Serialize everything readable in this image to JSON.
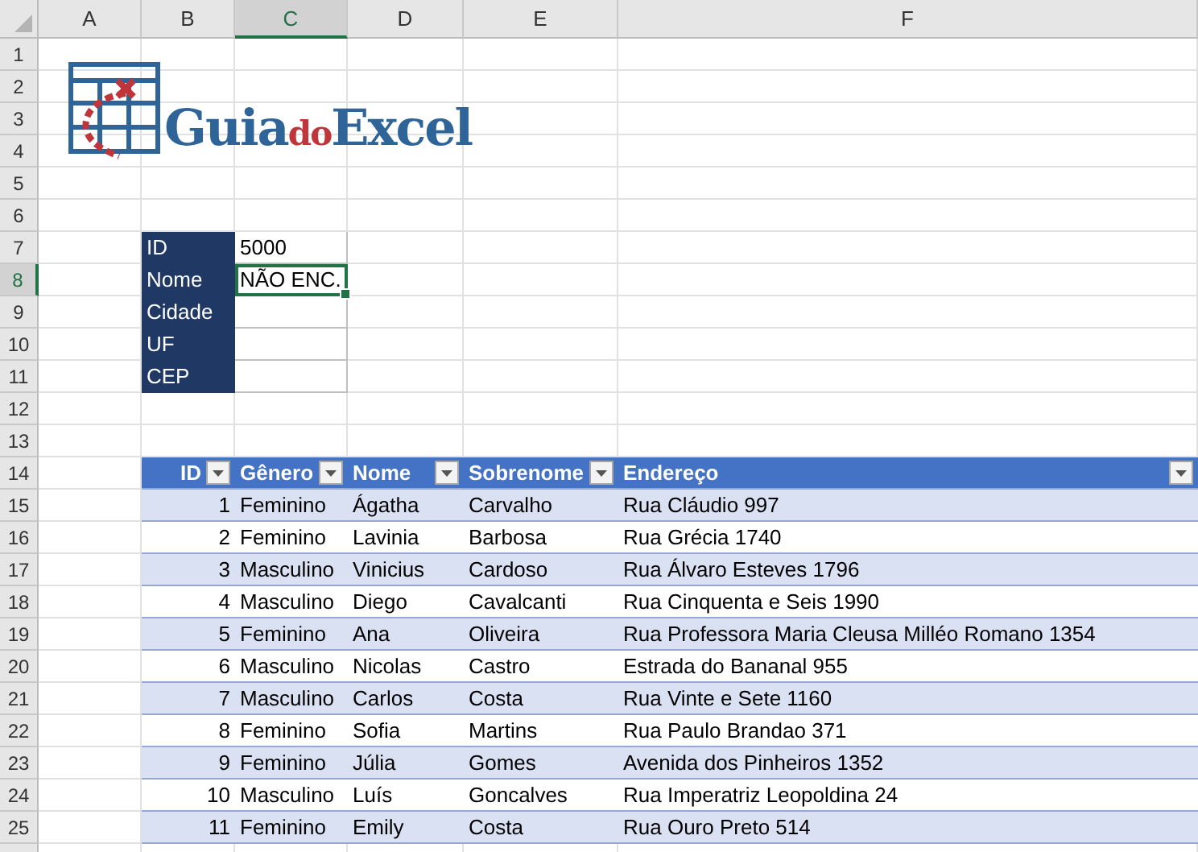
{
  "column_headers": [
    {
      "label": "A",
      "selected": false
    },
    {
      "label": "B",
      "selected": false
    },
    {
      "label": "C",
      "selected": true
    },
    {
      "label": "D",
      "selected": false
    },
    {
      "label": "E",
      "selected": false
    },
    {
      "label": "F",
      "selected": false
    }
  ],
  "row_numbers": [
    {
      "label": "1",
      "selected": false
    },
    {
      "label": "2",
      "selected": false
    },
    {
      "label": "3",
      "selected": false
    },
    {
      "label": "4",
      "selected": false
    },
    {
      "label": "5",
      "selected": false
    },
    {
      "label": "6",
      "selected": false
    },
    {
      "label": "7",
      "selected": false
    },
    {
      "label": "8",
      "selected": true
    },
    {
      "label": "9",
      "selected": false
    },
    {
      "label": "10",
      "selected": false
    },
    {
      "label": "11",
      "selected": false
    },
    {
      "label": "12",
      "selected": false
    },
    {
      "label": "13",
      "selected": false
    },
    {
      "label": "14",
      "selected": false
    },
    {
      "label": "15",
      "selected": false
    },
    {
      "label": "16",
      "selected": false
    },
    {
      "label": "17",
      "selected": false
    },
    {
      "label": "18",
      "selected": false
    },
    {
      "label": "19",
      "selected": false
    },
    {
      "label": "20",
      "selected": false
    },
    {
      "label": "21",
      "selected": false
    },
    {
      "label": "22",
      "selected": false
    },
    {
      "label": "23",
      "selected": false
    },
    {
      "label": "24",
      "selected": false
    },
    {
      "label": "25",
      "selected": false
    }
  ],
  "logo": {
    "parts": [
      "Guia",
      "do",
      "Excel"
    ]
  },
  "lookup": [
    {
      "label": "ID",
      "value": "5000",
      "selected": false
    },
    {
      "label": "Nome",
      "value": "NÃO ENC.",
      "selected": true
    },
    {
      "label": "Cidade",
      "selected": false
    },
    {
      "label": "UF",
      "selected": false
    },
    {
      "label": "CEP",
      "selected": false
    }
  ],
  "table": {
    "columns": [
      "ID",
      "Gênero",
      "Nome",
      "Sobrenome",
      "Endereço"
    ],
    "rows": [
      [
        "1",
        "Feminino",
        "Ágatha",
        "Carvalho",
        "Rua Cláudio 997"
      ],
      [
        "2",
        "Feminino",
        "Lavinia",
        "Barbosa",
        "Rua Grécia 1740"
      ],
      [
        "3",
        "Masculino",
        "Vinicius",
        "Cardoso",
        "Rua Álvaro Esteves 1796"
      ],
      [
        "4",
        "Masculino",
        "Diego",
        "Cavalcanti",
        "Rua Cinquenta e Seis 1990"
      ],
      [
        "5",
        "Feminino",
        "Ana",
        "Oliveira",
        "Rua Professora Maria Cleusa Milléo Romano 1354"
      ],
      [
        "6",
        "Masculino",
        "Nicolas",
        "Castro",
        "Estrada do Bananal 955"
      ],
      [
        "7",
        "Masculino",
        "Carlos",
        "Costa",
        "Rua Vinte e Sete 1160"
      ],
      [
        "8",
        "Feminino",
        "Sofia",
        "Martins",
        "Rua Paulo Brandao 371"
      ],
      [
        "9",
        "Feminino",
        "Júlia",
        "Gomes",
        "Avenida dos Pinheiros 1352"
      ],
      [
        "10",
        "Masculino",
        "Luís",
        "Goncalves",
        "Rua Imperatriz Leopoldina 24"
      ],
      [
        "11",
        "Feminino",
        "Emily",
        "Costa",
        "Rua Ouro Preto 514"
      ]
    ]
  }
}
